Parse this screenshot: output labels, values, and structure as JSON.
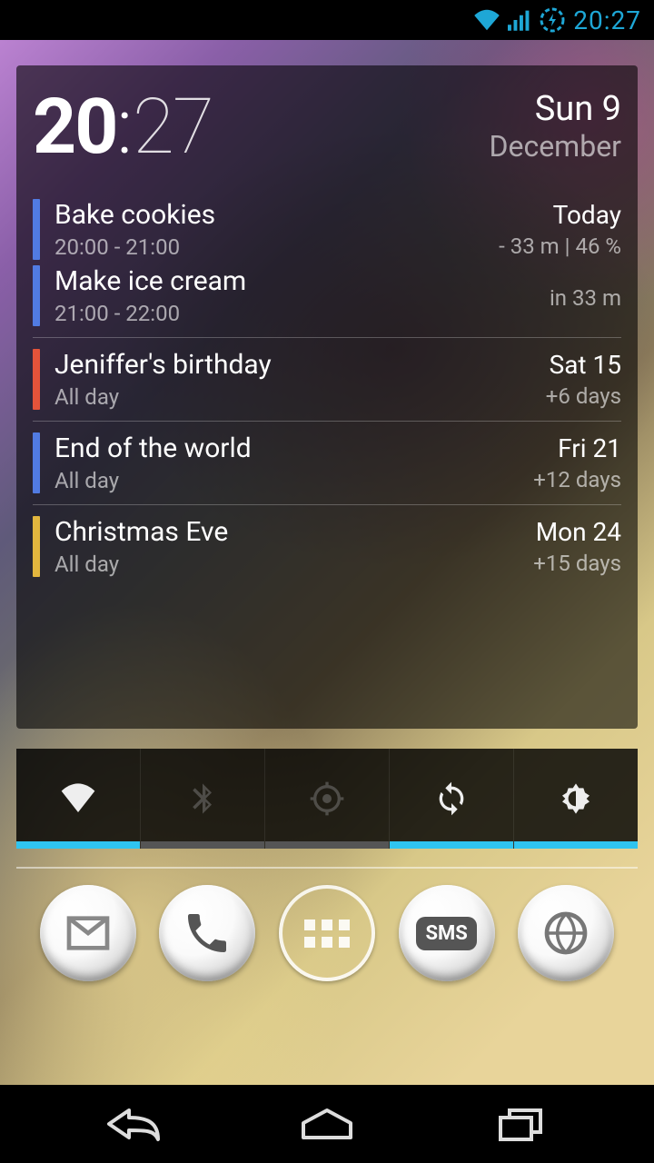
{
  "status_bar": {
    "time": "20:27"
  },
  "clock": {
    "hour": "20",
    "minute": "27",
    "day": "Sun 9",
    "month": "December"
  },
  "events": [
    {
      "title": "Bake cookies",
      "time": "20:00 - 21:00",
      "when": "Today",
      "rel": "- 33 m | 46 %",
      "color": "#517be2"
    },
    {
      "title": "Make ice cream",
      "time": "21:00 - 22:00",
      "when": "",
      "rel": "in 33 m",
      "color": "#517be2"
    },
    {
      "title": "Jeniffer's birthday",
      "time": "All day",
      "when": "Sat 15",
      "rel": "+6 days",
      "color": "#e4533a"
    },
    {
      "title": "End of the world",
      "time": "All day",
      "when": "Fri 21",
      "rel": "+12 days",
      "color": "#517be2"
    },
    {
      "title": "Christmas Eve",
      "time": "All day",
      "when": "Mon 24",
      "rel": "+15 days",
      "color": "#e2b63e"
    }
  ],
  "power_toggles": [
    {
      "name": "wifi",
      "on": true
    },
    {
      "name": "bluetooth",
      "on": false
    },
    {
      "name": "gps",
      "on": false
    },
    {
      "name": "sync",
      "on": true
    },
    {
      "name": "brightness",
      "on": true
    }
  ],
  "dock": {
    "gmail": "M",
    "sms": "SMS"
  }
}
